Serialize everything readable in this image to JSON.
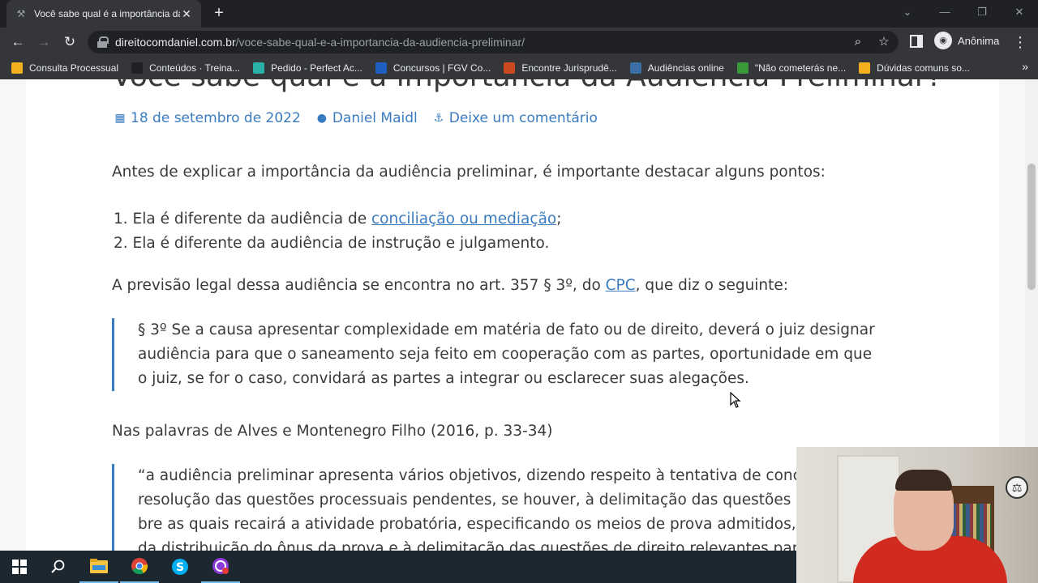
{
  "browser": {
    "tab": {
      "title": "Você sabe qual é a importância da audiência preliminar?"
    },
    "url": {
      "domain": "direitocomdaniel.com.br",
      "path": "/voce-sabe-qual-e-a-importancia-da-audiencia-preliminar/"
    },
    "profile_label": "Anônima",
    "bookmarks": [
      {
        "label": "Consulta Processual",
        "color": "#f2b01e"
      },
      {
        "label": "Conteúdos · Treina...",
        "color": "#202124"
      },
      {
        "label": "Pedido - Perfect Ac...",
        "color": "#2bb0a8"
      },
      {
        "label": "Concursos | FGV Co...",
        "color": "#1e5fbf"
      },
      {
        "label": "Encontre Jurisprudê...",
        "color": "#c94a1e"
      },
      {
        "label": "Audiências online",
        "color": "#3a6ea5"
      },
      {
        "label": "\"Não cometerás ne...",
        "color": "#3a9a3a"
      },
      {
        "label": "Dúvidas comuns so...",
        "color": "#f2b01e"
      }
    ]
  },
  "article": {
    "title": "Você sabe qual é a importância da Audiência Preliminar?",
    "meta": {
      "date": "18 de setembro de 2022",
      "author": "Daniel Maidl",
      "comment": "Deixe um comentário"
    },
    "intro": "Antes de explicar a importância da audiência preliminar, é importante destacar alguns pontos:",
    "list": {
      "item1_prefix": "1. Ela é diferente da audiência de ",
      "item1_link": "conciliação ou mediação",
      "item1_suffix": ";",
      "item2": "2. Ela é diferente da audiência de instrução e julgamento."
    },
    "legal": {
      "prefix": "A previsão legal dessa audiência se encontra no art. 357 § 3º, do ",
      "link": "CPC",
      "suffix": ", que diz o seguinte:"
    },
    "quote1": [
      "§ 3º Se a causa apresentar complexidade em matéria de fato ou de direito, deverá o juiz designar",
      "audiência para que o saneamento seja feito em cooperação com as partes, oportunidade em que",
      "o juiz, se for o caso, convidará as partes a integrar ou esclarecer suas alegações."
    ],
    "authors_line": "Nas palavras de Alves e Montenegro Filho (2016, p. 33-34)",
    "quote2": [
      "“a audiência preliminar apresenta vários objetivos, dizendo respeito à tentativa de conc",
      "resolução das questões processuais pendentes, se houver, à delimitação das questões c",
      "bre as quais recairá a atividade probatória, especificando os meios de prova admitidos,",
      "da distribuição do ônus da prova e à delimitação das questões de direito relevantes par"
    ]
  },
  "colors": {
    "link": "#3a7bbf",
    "text": "#3a3a3a",
    "chrome_dark": "#202124",
    "chrome_mid": "#35363a",
    "taskbar": "#1c2730"
  }
}
